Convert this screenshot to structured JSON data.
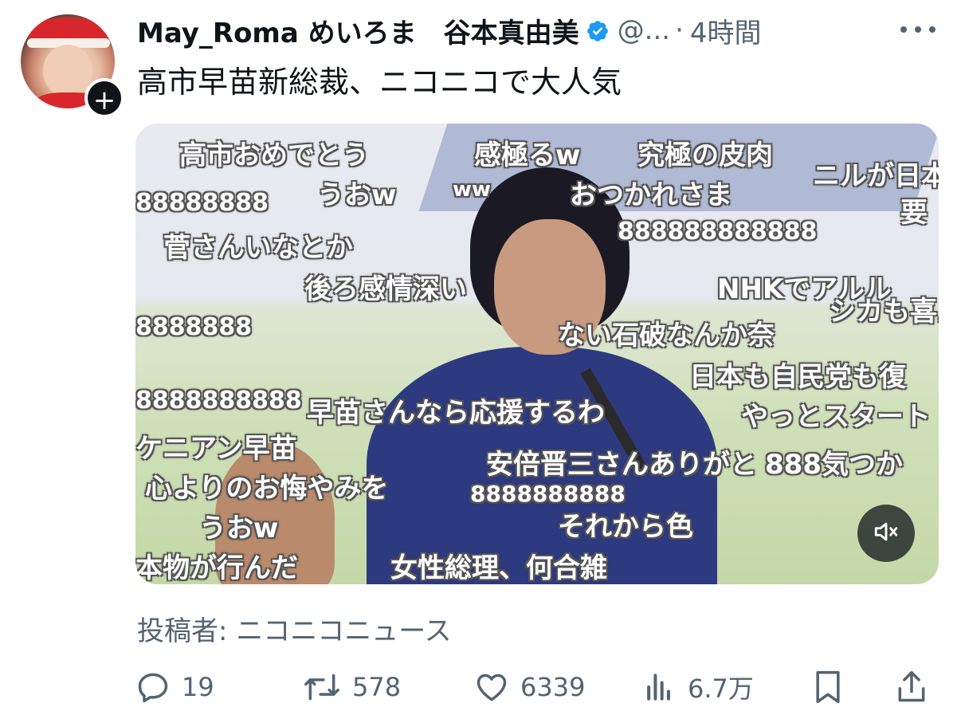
{
  "author": {
    "display_name": "May_Roma めいろま　谷本真由美",
    "handle": "@...",
    "separator": "·",
    "time": "4時間",
    "verified": true
  },
  "tweet": {
    "text": "高市早苗新総裁、ニコニコで大人気"
  },
  "media": {
    "type": "video",
    "muted": true,
    "comments": [
      "高市おめでとう",
      "感極るw",
      "究極の皮肉",
      "ニルが日本の",
      "うおw",
      "ww",
      "おつかれさま",
      "88888888",
      "要",
      "菅さんいなとか",
      "888888888888",
      "後ろ感情深い",
      "NHKでアルル",
      "8888888",
      "ない石破なんか奈",
      "シカも喜ん",
      "日本も自民党も復",
      "8888888888",
      "早苗さんなら応援するわ",
      "やっとスタート",
      "ケニアン早苗",
      "安倍晋三さんありがと",
      "888気つか",
      "心よりのお悔やみを",
      "8888888888",
      "それから色",
      "うおw",
      "女性総理、何合雑",
      "本物が行んだ"
    ]
  },
  "source": {
    "text": "投稿者: ニコニコニュース"
  },
  "actions": {
    "reply_count": "19",
    "repost_count": "578",
    "like_count": "6339",
    "view_count": "6.7万"
  },
  "icons": {
    "reply": "reply-icon",
    "repost": "repost-icon",
    "like": "like-icon",
    "views": "views-icon",
    "bookmark": "bookmark-icon",
    "share": "share-icon",
    "mute": "mute-icon",
    "more": "more-icon",
    "verified": "verified-icon",
    "follow": "plus-icon"
  },
  "colors": {
    "text_primary": "#0f1419",
    "text_secondary": "#536471",
    "verified_blue": "#1d9bf0"
  }
}
